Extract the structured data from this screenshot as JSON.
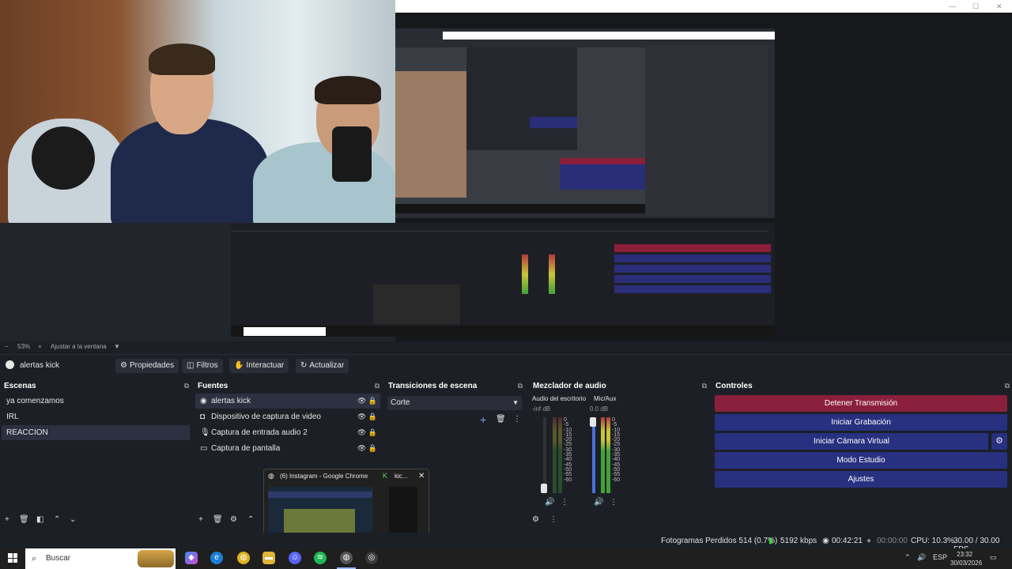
{
  "preview": {
    "zoom_label": "53%",
    "zoom_minus": "−",
    "zoom_plus": "+",
    "fit_label": "Ajustar a la ventana"
  },
  "source_toolbar": {
    "source_name": "alertas kick",
    "buttons": [
      "Propiedades",
      "Filtros",
      "Interactuar",
      "Actualizar"
    ]
  },
  "scenes": {
    "title": "Escenas",
    "items": [
      "ya comenzamos",
      "IRL",
      "REACCION"
    ],
    "selected": "REACCION"
  },
  "sources": {
    "title": "Fuentes",
    "items": [
      "alertas kick",
      "Dispositivo de captura de video",
      "Captura de entrada audio 2",
      "Captura de pantalla"
    ]
  },
  "transitions": {
    "title": "Transiciones de escena",
    "selected": "Corte"
  },
  "mixer": {
    "title": "Mezclador de audio",
    "channels": [
      {
        "name": "Audio del escritorio",
        "db": "-inf dB"
      },
      {
        "name": "Mic/Aux",
        "db": "0.0 dB"
      }
    ],
    "scale": [
      "0",
      "-5",
      "-10",
      "-15",
      "-20",
      "-25",
      "-30",
      "-35",
      "-40",
      "-45",
      "-50",
      "-55",
      "-60"
    ]
  },
  "controls": {
    "title": "Controles",
    "buttons": [
      "Detener Transmisión",
      "Iniciar Grabación",
      "Iniciar Cámara Virtual",
      "Modo Estudio",
      "Ajustes"
    ]
  },
  "taskbar_preview": {
    "window1": "(6) Instagram - Google Chrome",
    "window2": "kic..."
  },
  "status": {
    "dropped": "Fotogramas Perdidos 514 (0.7%)",
    "bitrate": "5192 kbps",
    "stream_time": "00:42:21",
    "rec_time": "00:00:00",
    "cpu": "CPU: 10.3%",
    "fps": "30.00 / 30.00 FPS"
  },
  "taskbar": {
    "search_placeholder": "Buscar",
    "lang": "ESP",
    "time": "23:32",
    "date": "30/03/2026"
  },
  "colors": {
    "stop_button": "#8a1f3c",
    "control_button": "#283080",
    "panel_bg": "#1d1f26"
  }
}
